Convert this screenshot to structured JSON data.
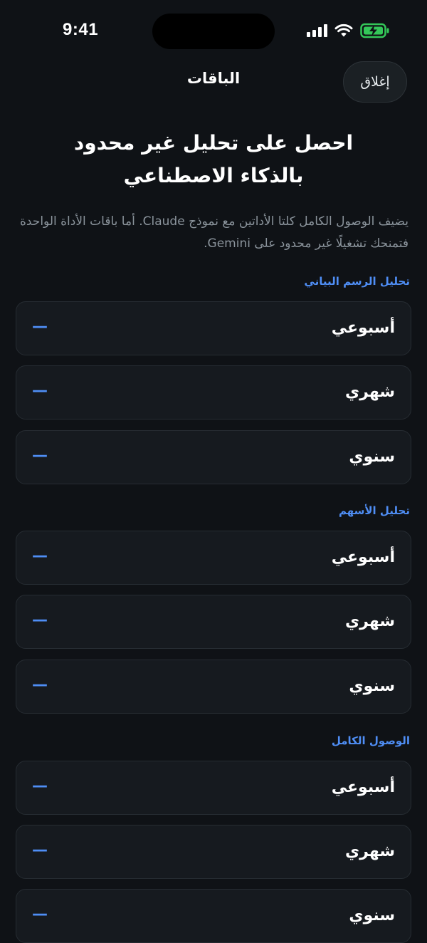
{
  "status_bar": {
    "time": "9:41"
  },
  "header": {
    "title": "الباقات",
    "close_label": "إغلاق"
  },
  "hero": {
    "title_line1": "احصل على تحليل غير محدود",
    "title_line2": "بالذكاء الاصطناعي",
    "description": "يضيف الوصول الكامل كلتا الأداتين مع نموذج Claude. أما باقات الأداة الواحدة فتمنحك تشغيلًا غير محدود على Gemini."
  },
  "sections": [
    {
      "label": "تحليل الرسم البياني",
      "plans": [
        {
          "name": "أسبوعي",
          "price": "—"
        },
        {
          "name": "شهري",
          "price": "—"
        },
        {
          "name": "سنوي",
          "price": "—"
        }
      ]
    },
    {
      "label": "تحليل الأسهم",
      "plans": [
        {
          "name": "أسبوعي",
          "price": "—"
        },
        {
          "name": "شهري",
          "price": "—"
        },
        {
          "name": "سنوي",
          "price": "—"
        }
      ]
    },
    {
      "label": "الوصول الكامل",
      "plans": [
        {
          "name": "أسبوعي",
          "price": "—"
        },
        {
          "name": "شهري",
          "price": "—"
        },
        {
          "name": "سنوي",
          "price": "—"
        }
      ]
    }
  ],
  "colors": {
    "background": "#0f1216",
    "card": "#161a1f",
    "accent": "#4f8ef5",
    "battery": "#34c759"
  }
}
